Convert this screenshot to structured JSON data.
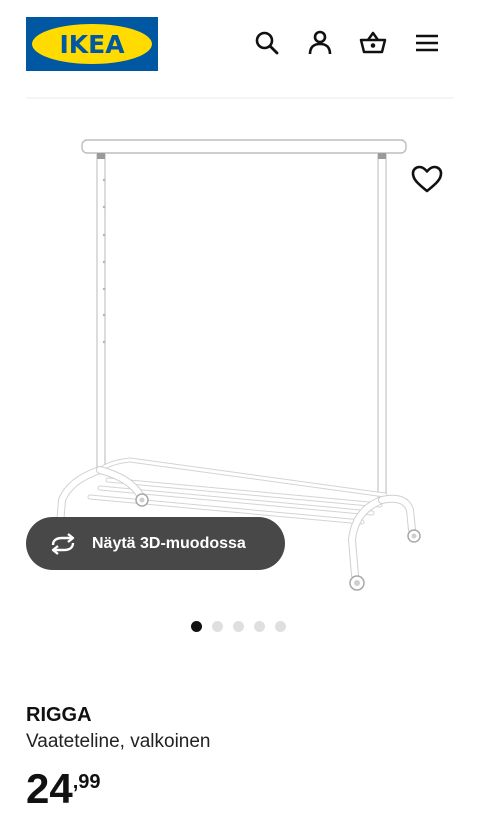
{
  "header": {
    "logo_text": "IKEA",
    "icons": [
      "search-icon",
      "user-icon",
      "basket-icon",
      "menu-icon"
    ]
  },
  "gallery": {
    "image": "rigga-clothes-rack",
    "favourite_icon": "heart-icon",
    "view_3d_label": "Näytä 3D-muodossa",
    "view_3d_icon": "rotate-icon",
    "dot_count": 5,
    "active_dot": 1
  },
  "product": {
    "name": "RIGGA",
    "description": "Vaateteline, valkoinen",
    "price_integer": "24",
    "price_decimal": ",99"
  },
  "colors": {
    "ikea_blue": "#0058a3",
    "ikea_yellow": "#ffdb00",
    "button_bg": "#484848",
    "dot_active": "#111111",
    "dot_inactive": "#dfdfdf"
  }
}
